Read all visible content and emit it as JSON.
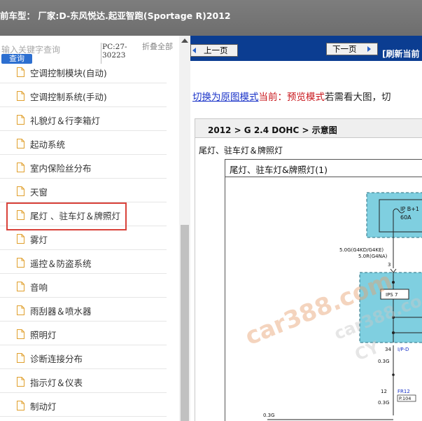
{
  "header": {
    "title": "前车型：  厂家:D-东风悦达.起亚智跑(Sportage R)2012"
  },
  "search": {
    "placeholder": "输入关键字查询",
    "button_label": "查询"
  },
  "pc_code": "PC:27-30223",
  "collapse_label": "折叠全部",
  "sidebar": {
    "items": [
      {
        "label": "空调控制模块(自动)"
      },
      {
        "label": "空调控制系统(手动)"
      },
      {
        "label": "礼貌灯＆行李箱灯"
      },
      {
        "label": "起动系统"
      },
      {
        "label": "室内保险丝分布"
      },
      {
        "label": "天窗"
      },
      {
        "label": "尾灯 、驻车灯＆牌照灯",
        "selected": true
      },
      {
        "label": "雾灯"
      },
      {
        "label": "遥控＆防盗系统"
      },
      {
        "label": "音响"
      },
      {
        "label": "雨刮器＆喷水器"
      },
      {
        "label": "照明灯"
      },
      {
        "label": "诊断连接分布"
      },
      {
        "label": "指示灯＆仪表"
      },
      {
        "label": "制动灯"
      }
    ]
  },
  "toolbar": {
    "prev_label": "上一页",
    "next_label": "下一页",
    "refresh_label": "[刷新当前"
  },
  "mode": {
    "switch_link": "切换为原图模式",
    "current": "当前：预览模式",
    "hint": "若需看大图，切"
  },
  "document": {
    "breadcrumb": "2012 > G 2.4 DOHC > 示意图",
    "section_title": "尾灯、驻车灯＆牌照灯",
    "diagram_title": "尾灯、驻车灯&牌照灯(1)"
  },
  "diagram": {
    "fuse_label": "IP B+1",
    "fuse_rating": "60A",
    "wire_1": "5.0G(G4KD/G4KE)",
    "wire_2": "5.0R(G4NA)",
    "pin_3": "3",
    "ips_label": "IPS 7",
    "pin_34": "34",
    "connector_ipd": "I/P-D",
    "wire_3": "0.3G",
    "connector_fr": "FR12",
    "page_ref": "P.104",
    "pin_12": "12",
    "wire_4": "0.3G",
    "wire_5": "0.3G"
  },
  "watermark": {
    "main": "car388.com",
    "secondary": "car388.co",
    "tertiary": "CY"
  },
  "colors": {
    "nav_blue": "#0b3d91",
    "highlight_red": "#d9423a",
    "link_blue": "#1a33c8",
    "current_red": "#c8141a",
    "module_cyan": "#7fcfe0"
  }
}
